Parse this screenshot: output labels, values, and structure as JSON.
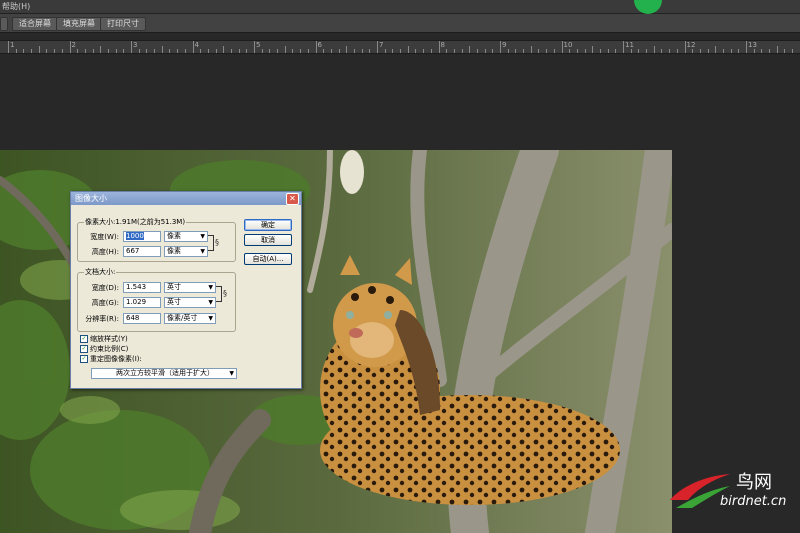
{
  "menubar": {
    "help_label": "帮助(H)"
  },
  "options_bar": {
    "buttons": [
      "适合屏幕",
      "填充屏幕",
      "打印尺寸"
    ]
  },
  "ruler": {
    "labels": [
      "1",
      "2",
      "3",
      "4",
      "5",
      "6",
      "7",
      "8",
      "9",
      "10",
      "11",
      "12",
      "13"
    ]
  },
  "dialog": {
    "title": "图像大小",
    "pixel_dimensions": {
      "label": "像素大小:1.91M(之前为51.3M)",
      "width_label": "宽度(W):",
      "width_value": "1000",
      "width_unit": "像素",
      "height_label": "高度(H):",
      "height_value": "667",
      "height_unit": "像素"
    },
    "document_size": {
      "label": "文档大小:",
      "width_label": "宽度(D):",
      "width_value": "1.543",
      "width_unit": "英寸",
      "height_label": "高度(G):",
      "height_value": "1.029",
      "height_unit": "英寸",
      "resolution_label": "分辨率(R):",
      "resolution_value": "648",
      "resolution_unit": "像素/英寸"
    },
    "checkboxes": [
      {
        "label": "缩放样式(Y)",
        "checked": true
      },
      {
        "label": "约束比例(C)",
        "checked": true
      },
      {
        "label": "重定图像像素(I):",
        "checked": true
      }
    ],
    "resample_method": "两次立方较平滑（适用于扩大）",
    "buttons": {
      "ok": "确定",
      "cancel": "取消",
      "auto": "自动(A)..."
    }
  },
  "watermark": {
    "cn": "鸟网",
    "url": "birdnet.cn"
  },
  "colors": {
    "dialog_bg": "#ece9d8",
    "titlebar": "#7d99c8",
    "canvas_bg": "#282828",
    "accent_green": "#22b14c"
  }
}
